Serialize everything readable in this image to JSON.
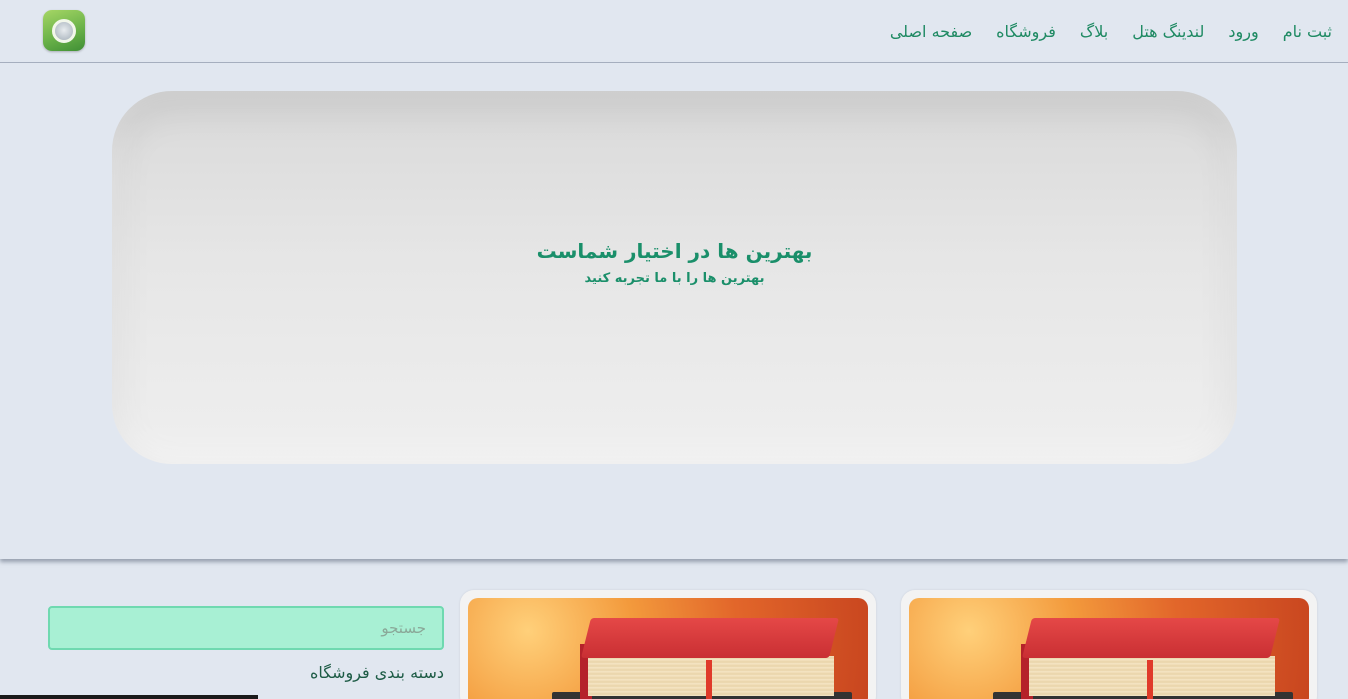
{
  "nav": {
    "links": [
      "صفحه اصلی",
      "فروشگاه",
      "بلاگ",
      "لندینگ هتل",
      "ورود",
      "ثبت نام"
    ]
  },
  "logo": {
    "icon": "camera-lens-icon",
    "color": "#6cb34a"
  },
  "hero": {
    "title": "بهترین ها در اختیار شماست",
    "subtitle": "بهترین ها را با ما تجربه کنید"
  },
  "search": {
    "placeholder": "جستجو",
    "value": ""
  },
  "shop": {
    "category_heading": "دسته بندی فروشگاه"
  },
  "products": [
    {
      "image": "books-image"
    },
    {
      "image": "books-image"
    }
  ],
  "colors": {
    "accent": "#1a8f6a",
    "background": "#e1e7f0",
    "search_bg": "#a8f0d4"
  }
}
